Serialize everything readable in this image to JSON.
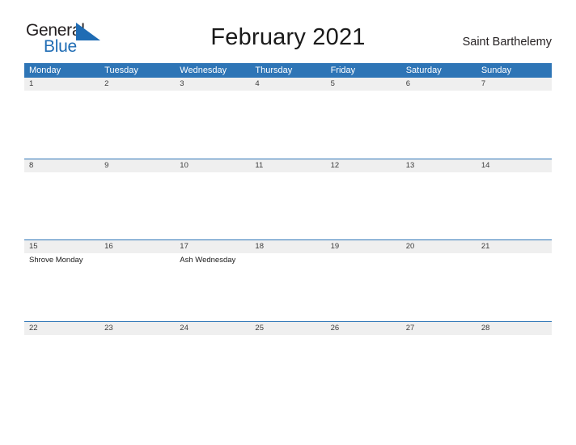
{
  "brand": {
    "name_part1": "General",
    "name_part2": "Blue",
    "triangle_icon": "triangle-icon",
    "color_dark": "#231f20",
    "color_blue": "#1f6cb4"
  },
  "header": {
    "title": "February 2021",
    "location": "Saint Barthelemy"
  },
  "theme": {
    "header_bar": "#2e75b6",
    "daynum_band": "#efefef",
    "week_divider": "#2e75b6",
    "text": "#1a1a1a"
  },
  "weekdays": [
    "Monday",
    "Tuesday",
    "Wednesday",
    "Thursday",
    "Friday",
    "Saturday",
    "Sunday"
  ],
  "weeks": [
    {
      "days": [
        {
          "num": "1",
          "events": []
        },
        {
          "num": "2",
          "events": []
        },
        {
          "num": "3",
          "events": []
        },
        {
          "num": "4",
          "events": []
        },
        {
          "num": "5",
          "events": []
        },
        {
          "num": "6",
          "events": []
        },
        {
          "num": "7",
          "events": []
        }
      ]
    },
    {
      "days": [
        {
          "num": "8",
          "events": []
        },
        {
          "num": "9",
          "events": []
        },
        {
          "num": "10",
          "events": []
        },
        {
          "num": "11",
          "events": []
        },
        {
          "num": "12",
          "events": []
        },
        {
          "num": "13",
          "events": []
        },
        {
          "num": "14",
          "events": []
        }
      ]
    },
    {
      "days": [
        {
          "num": "15",
          "events": [
            "Shrove Monday"
          ]
        },
        {
          "num": "16",
          "events": []
        },
        {
          "num": "17",
          "events": [
            "Ash Wednesday"
          ]
        },
        {
          "num": "18",
          "events": []
        },
        {
          "num": "19",
          "events": []
        },
        {
          "num": "20",
          "events": []
        },
        {
          "num": "21",
          "events": []
        }
      ]
    },
    {
      "days": [
        {
          "num": "22",
          "events": []
        },
        {
          "num": "23",
          "events": []
        },
        {
          "num": "24",
          "events": []
        },
        {
          "num": "25",
          "events": []
        },
        {
          "num": "26",
          "events": []
        },
        {
          "num": "27",
          "events": []
        },
        {
          "num": "28",
          "events": []
        }
      ]
    }
  ]
}
